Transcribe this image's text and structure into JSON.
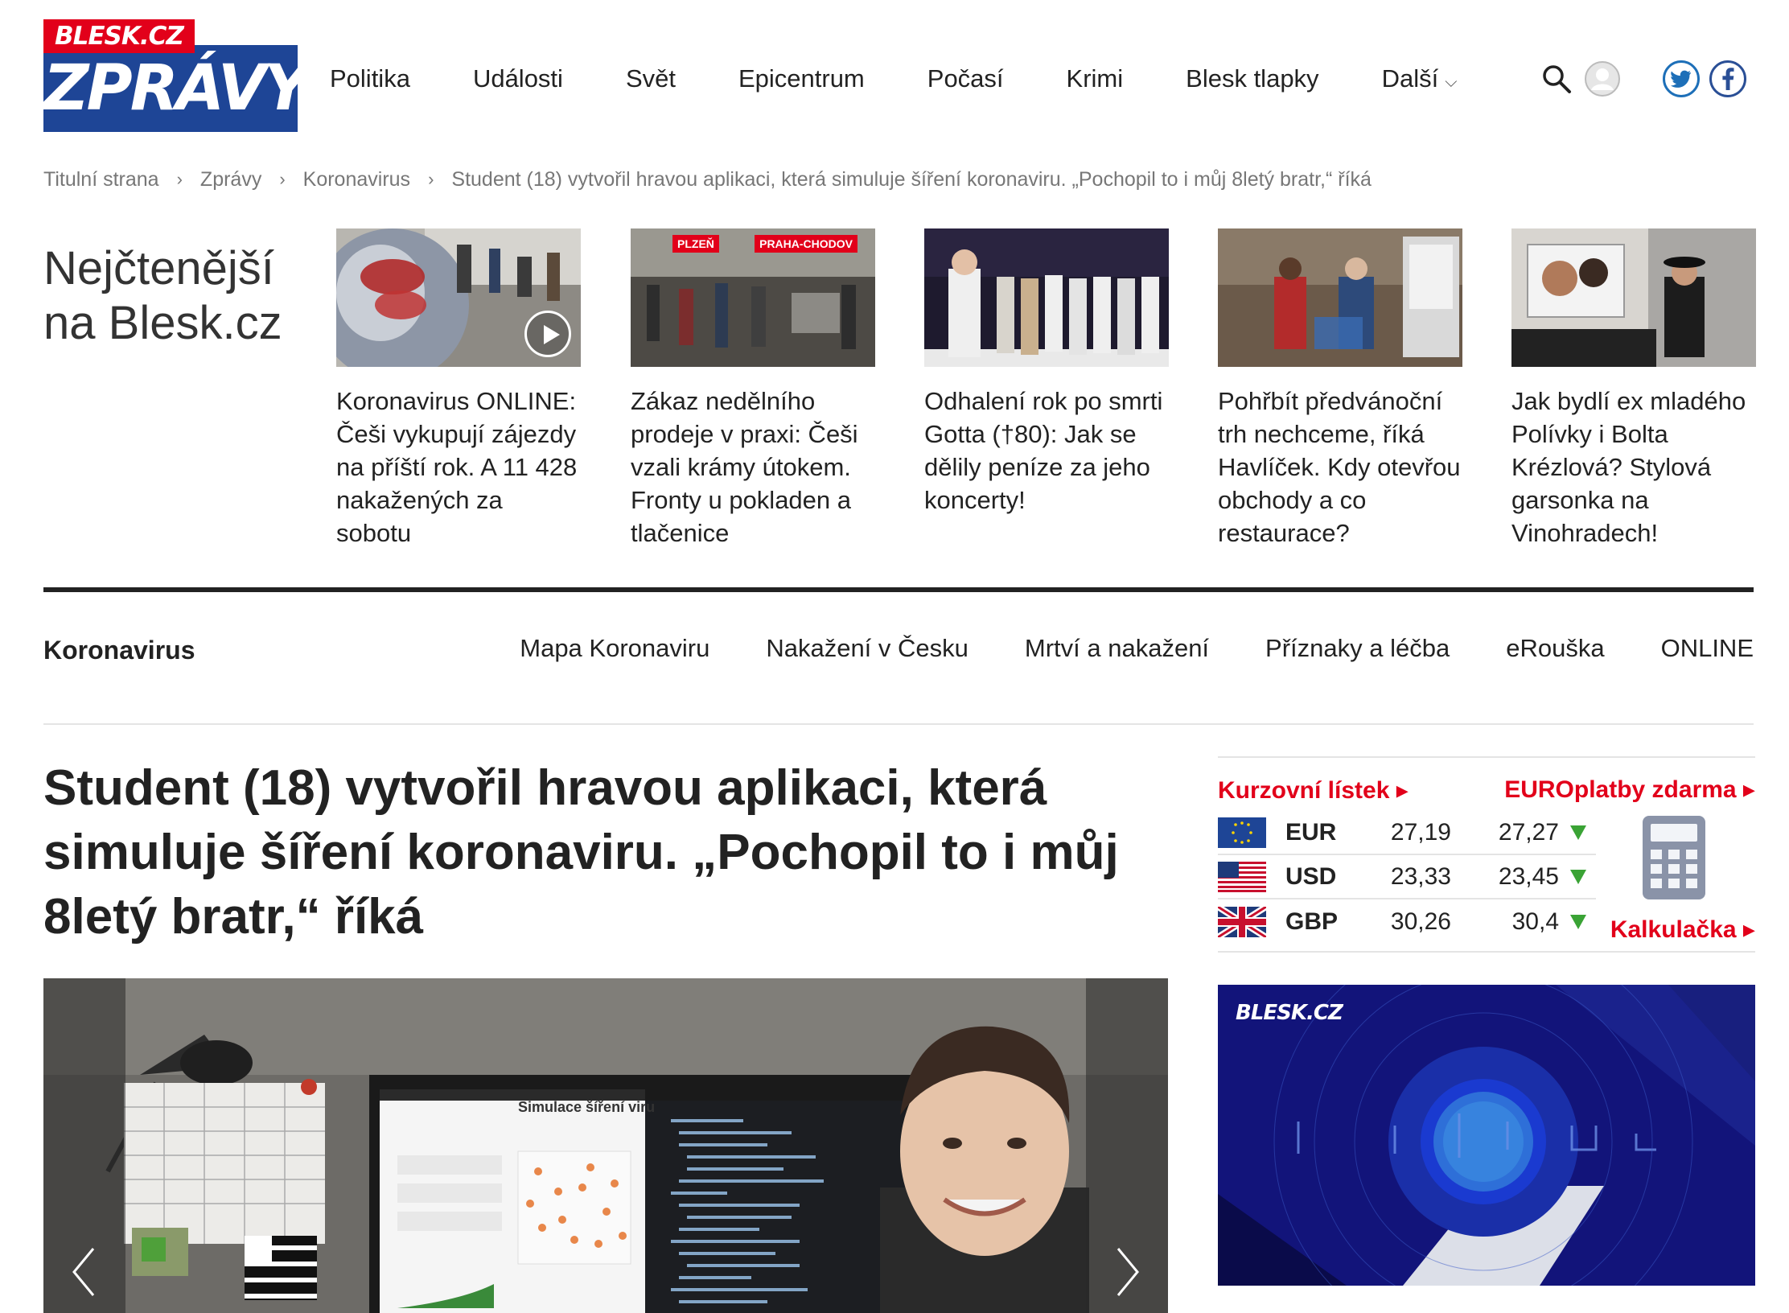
{
  "logo": {
    "top": "BLESK.CZ",
    "bottom": "ZPRÁVY"
  },
  "main_nav": [
    "Politika",
    "Události",
    "Svět",
    "Epicentrum",
    "Počasí",
    "Krimi",
    "Blesk tlapky",
    "Další"
  ],
  "header_icons": [
    "search-icon",
    "user-icon",
    "twitter-icon",
    "facebook-icon"
  ],
  "breadcrumb": [
    "Titulní strana",
    "Zprávy",
    "Koronavirus",
    "Student (18) vytvořil hravou aplikaci, která simuluje šíření koronaviru. „Pochopil to i můj 8letý bratr,“ říká"
  ],
  "most_read": {
    "title": "Nejčtenější na Blesk.cz",
    "items": [
      {
        "text": "Koronavirus ONLINE: Češi vykupují zájezdy na příští rok. A 11 428 nakažených za sobotu"
      },
      {
        "text": "Zákaz nedělního prodeje v praxi: Češi vzali krámy útokem. Fronty u pokladen a tlačenice",
        "tags": [
          "PLZEŇ",
          "PRAHA-CHODOV"
        ]
      },
      {
        "text": "Odhalení rok po smrti Gotta (†80): Jak se dělily peníze za jeho koncerty!"
      },
      {
        "text": "Pohřbít předvánoční trh nechceme, říká Havlíček. Kdy otevřou obchody a co restaurace?"
      },
      {
        "text": "Jak bydlí ex mladého Polívky i Bolta Krézlová? Stylová garsonka na Vinohradech!"
      }
    ]
  },
  "section": {
    "name": "Koronavirus",
    "links": [
      "Mapa Koronaviru",
      "Nakažení v Česku",
      "Mrtví a nakažení",
      "Příznaky a léčba",
      "eRouška",
      "ONLINE"
    ]
  },
  "article": {
    "title": "Student (18) vytvořil hravou aplikaci, která simuluje šíření koronaviru. „Pochopil to i můj 8letý bratr,“ říká",
    "gallery_screen_title": "Simulace šíření viru"
  },
  "currency": {
    "left_link": "Kurzovní lístek ▸",
    "right_link": "EUROplatby zdarma ▸",
    "calc_link": "Kalkulačka ▸",
    "trend_color": "#3aa335",
    "rows": [
      {
        "code": "EUR",
        "buy": "27,19",
        "sell": "27,27",
        "trend": "down",
        "flag": "eu-flag-icon"
      },
      {
        "code": "USD",
        "buy": "23,33",
        "sell": "23,45",
        "trend": "down",
        "flag": "us-flag-icon"
      },
      {
        "code": "GBP",
        "buy": "30,26",
        "sell": "30,4",
        "trend": "down",
        "flag": "uk-flag-icon"
      }
    ]
  },
  "video_banner": {
    "logo": "BLESK.CZ"
  },
  "colors": {
    "brand_red": "#e2001a",
    "brand_blue": "#1e4596",
    "banner_blue": "#12147a"
  }
}
